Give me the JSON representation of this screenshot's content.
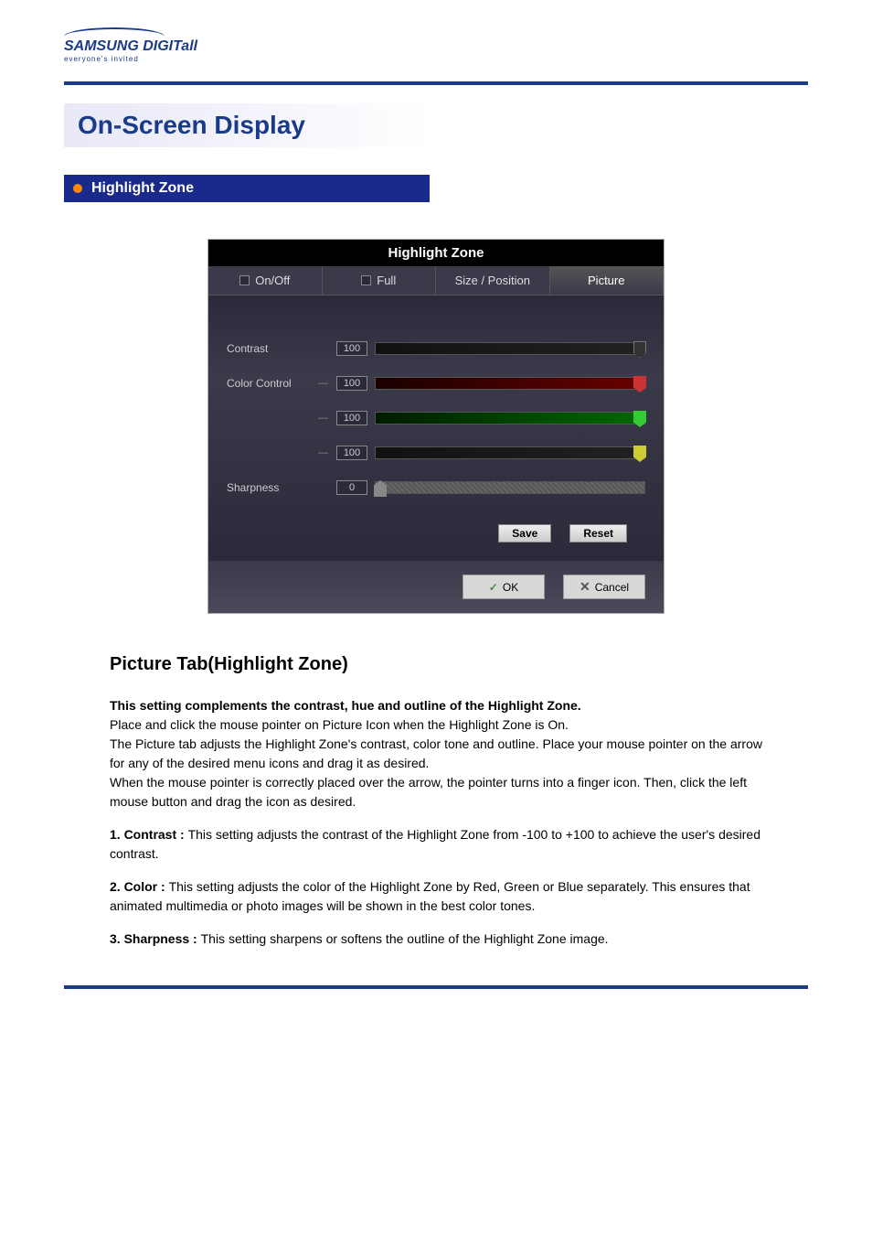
{
  "logo": {
    "main": "SAMSUNG DIGITall",
    "sub": "everyone's invited"
  },
  "page_title": "On-Screen Display",
  "section_title": "Highlight Zone",
  "dialog": {
    "title": "Highlight Zone",
    "tabs": {
      "onoff": "On/Off",
      "full": "Full",
      "size_position": "Size / Position",
      "picture": "Picture"
    },
    "sliders": {
      "contrast": {
        "label": "Contrast",
        "value": "100"
      },
      "color_control": {
        "label": "Color Control",
        "value": "100"
      },
      "green": {
        "value": "100"
      },
      "blue": {
        "value": "100"
      },
      "sharpness": {
        "label": "Sharpness",
        "value": "0"
      }
    },
    "buttons": {
      "save": "Save",
      "reset": "Reset",
      "ok": "OK",
      "cancel": "Cancel"
    }
  },
  "content": {
    "heading": "Picture Tab(Highlight Zone)",
    "bold_intro": "This setting complements the contrast, hue and outline of the Highlight Zone.",
    "intro1": "Place and click the mouse pointer on Picture Icon when the Highlight Zone is On.",
    "intro2": "The Picture tab adjusts the Highlight Zone's contrast, color tone and outline. Place your mouse pointer on the arrow for any of the desired menu icons and drag it as desired.",
    "intro3": "When the mouse pointer is correctly placed over the arrow, the pointer turns into a finger icon. Then, click the left mouse button and drag the icon as desired.",
    "item1_label": "1. Contrast : ",
    "item1_text": "This setting adjusts the contrast of the Highlight Zone from -100 to +100 to achieve the user's desired contrast.",
    "item2_label": "2. Color : ",
    "item2_text": "This setting adjusts the color of the Highlight Zone by Red, Green or Blue separately. This ensures that animated multimedia or photo images will be shown in the best color tones.",
    "item3_prefix": "3",
    "item3_label": ". Sharpness :  ",
    "item3_text": "This setting sharpens or softens the outline of the Highlight Zone image."
  }
}
